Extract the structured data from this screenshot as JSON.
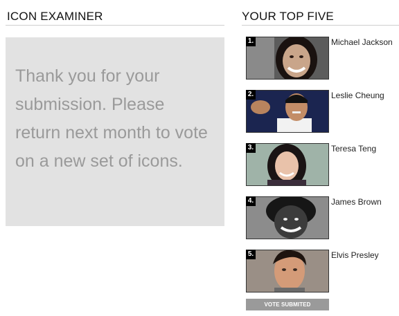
{
  "left_section": {
    "title": "ICON EXAMINER",
    "message": "Thank you for your\nsubmission.  Please\nreturn next month to vote\non a new set of icons."
  },
  "right_section": {
    "title": "YOUR TOP FIVE",
    "items": [
      {
        "rank": "1.",
        "name": "Michael Jackson"
      },
      {
        "rank": "2.",
        "name": "Leslie Cheung"
      },
      {
        "rank": "3.",
        "name": "Teresa Teng"
      },
      {
        "rank": "4.",
        "name": "James Brown"
      },
      {
        "rank": "5.",
        "name": "Elvis Presley"
      }
    ],
    "vote_button": "VOTE SUBMITED"
  }
}
